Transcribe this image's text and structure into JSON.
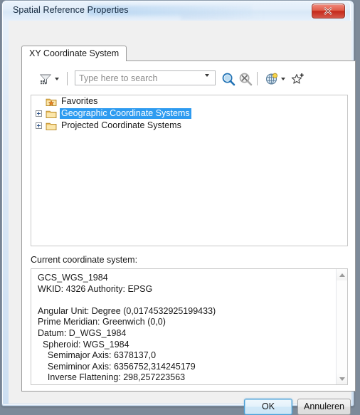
{
  "window": {
    "title": "Spatial Reference Properties",
    "close_icon": "close-x-icon"
  },
  "tabs": [
    {
      "label": "XY Coordinate System",
      "active": true
    }
  ],
  "toolbar": {
    "filter_icon": "funnel-filter-icon",
    "filter_dropdown_icon": "chevron-down-icon",
    "search": {
      "placeholder": "Type here to search",
      "value": "",
      "dropdown_icon": "chevron-down-icon"
    },
    "search_button_icon": "magnifier-search-icon",
    "clear_search_button_icon": "magnifier-clear-icon",
    "globe_button_icon": "globe-icon",
    "globe_dropdown_icon": "chevron-down-icon",
    "add_favorite_button_icon": "star-add-icon"
  },
  "tree": {
    "items": [
      {
        "label": "Favorites",
        "icon": "folder-favorites-star-icon",
        "expandable": false,
        "selected": false
      },
      {
        "label": "Geographic Coordinate Systems",
        "icon": "folder-icon",
        "expandable": true,
        "selected": true
      },
      {
        "label": "Projected Coordinate Systems",
        "icon": "folder-icon",
        "expandable": true,
        "selected": false
      }
    ]
  },
  "current_coordinate_system": {
    "label": "Current coordinate system:",
    "details": "GCS_WGS_1984\nWKID: 4326 Authority: EPSG\n\nAngular Unit: Degree (0,0174532925199433)\nPrime Meridian: Greenwich (0,0)\nDatum: D_WGS_1984\n  Spheroid: WGS_1984\n    Semimajor Axis: 6378137,0\n    Semiminor Axis: 6356752,314245179\n    Inverse Flattening: 298,257223563",
    "scroll_up_icon": "triangle-up-icon",
    "scroll_down_icon": "triangle-down-icon"
  },
  "footer": {
    "ok_label": "OK",
    "cancel_label": "Annuleren"
  },
  "colors": {
    "selection_highlight": "#2e9bf0",
    "close_button": "#c5291a",
    "default_button_border": "#4b9fd6",
    "folder_icon": "#e8b54d",
    "title_text": "#14293f"
  }
}
